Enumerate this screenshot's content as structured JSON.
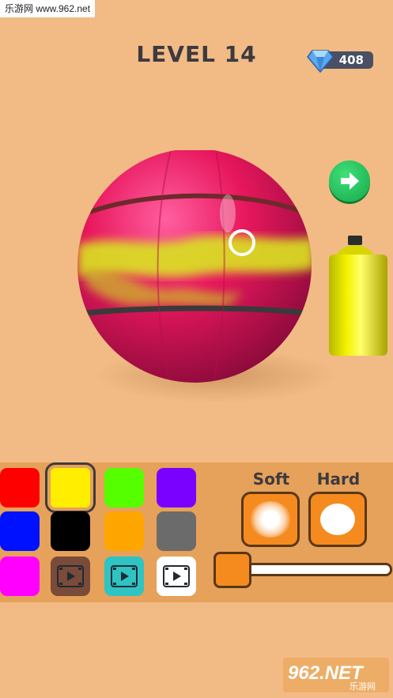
{
  "watermark": {
    "top_text": "乐游网 www.962.net",
    "logo_text": "962.NET",
    "logo_sub": "乐游网"
  },
  "hud": {
    "level_label": "LEVEL 14",
    "gems": "408"
  },
  "icons": {
    "gem": "diamond-icon",
    "next": "arrow-right-icon",
    "ad": "video-play-icon"
  },
  "palette": {
    "swatches": [
      {
        "name": "red",
        "color": "#ff0000"
      },
      {
        "name": "yellow",
        "color": "#ffee00",
        "selected": true
      },
      {
        "name": "green",
        "color": "#55ff00"
      },
      {
        "name": "purple",
        "color": "#7a00ff"
      },
      {
        "name": "blue",
        "color": "#0011ff"
      },
      {
        "name": "black",
        "color": "#000000"
      },
      {
        "name": "orange",
        "color": "#ffa500"
      },
      {
        "name": "gray",
        "color": "#6b6b6b"
      },
      {
        "name": "magenta",
        "color": "#ff00ff"
      },
      {
        "name": "locked-brown",
        "color": "#7a4b3a",
        "video_locked": true
      },
      {
        "name": "locked-teal",
        "color": "#2ec4c4",
        "video_locked": true
      },
      {
        "name": "locked-white",
        "color": "#ffffff",
        "video_locked": true
      }
    ]
  },
  "brush": {
    "soft_label": "Soft",
    "hard_label": "Hard",
    "size_level": 0.0
  },
  "colors": {
    "background": "#f2bb85",
    "panel": "#e6a15a",
    "ball": "#e8175d",
    "paint": "#d9e420",
    "accent_orange": "#f58a1f",
    "next_green": "#22c55e"
  }
}
